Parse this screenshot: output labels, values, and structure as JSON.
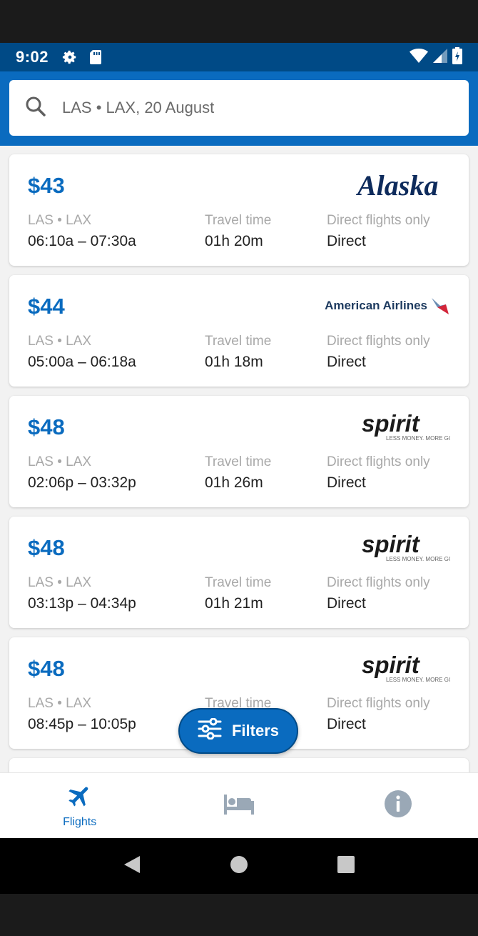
{
  "status_bar": {
    "time": "9:02"
  },
  "search": {
    "query": "LAS • LAX, 20 August"
  },
  "flights": [
    {
      "price": "$43",
      "airline": "Alaska",
      "route": "LAS • LAX",
      "times": "06:10a – 07:30a",
      "travel_label": "Travel time",
      "travel": "01h 20m",
      "direct_label": "Direct flights only",
      "direct": "Direct"
    },
    {
      "price": "$44",
      "airline": "American Airlines",
      "route": "LAS • LAX",
      "times": "05:00a – 06:18a",
      "travel_label": "Travel time",
      "travel": "01h 18m",
      "direct_label": "Direct flights only",
      "direct": "Direct"
    },
    {
      "price": "$48",
      "airline": "spirit",
      "route": "LAS • LAX",
      "times": "02:06p – 03:32p",
      "travel_label": "Travel time",
      "travel": "01h 26m",
      "direct_label": "Direct flights only",
      "direct": "Direct"
    },
    {
      "price": "$48",
      "airline": "spirit",
      "route": "LAS • LAX",
      "times": "03:13p – 04:34p",
      "travel_label": "Travel time",
      "travel": "01h 21m",
      "direct_label": "Direct flights only",
      "direct": "Direct"
    },
    {
      "price": "$48",
      "airline": "spirit",
      "route": "LAS • LAX",
      "times": "08:45p – 10:05p",
      "travel_label": "Travel time",
      "travel": "",
      "direct_label": "Direct flights only",
      "direct": "Direct"
    }
  ],
  "spirit_tagline": "LESS MONEY. MORE GO.",
  "filters": {
    "label": "Filters"
  },
  "bottom_nav": [
    {
      "label": "Flights",
      "icon": "airplane-icon"
    },
    {
      "label": "",
      "icon": "bed-icon"
    },
    {
      "label": "",
      "icon": "info-icon"
    }
  ],
  "colors": {
    "primary": "#0a6bbf",
    "status_bar": "#004a86",
    "background": "#f2f2f2"
  }
}
